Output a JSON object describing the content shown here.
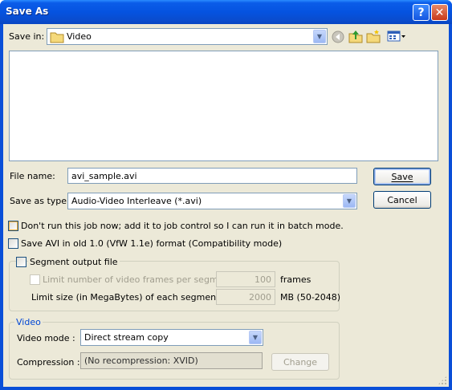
{
  "window": {
    "title": "Save As",
    "help_symbol": "?",
    "close_symbol": "✕"
  },
  "save_in": {
    "label": "Save in:",
    "folder": "Video",
    "icons": [
      "folder-icon",
      "back-icon",
      "up-folder-icon",
      "new-folder-icon",
      "view-menu-icon"
    ]
  },
  "file_name": {
    "label": "File name:",
    "value": "avi_sample.avi"
  },
  "save_as_type": {
    "label": "Save as type:",
    "value": "Audio-Video Interleave (*.avi)"
  },
  "buttons": {
    "save": "Save",
    "cancel": "Cancel",
    "change": "Change"
  },
  "options": {
    "batch_mode": "Don't run this job now; add it to job control so I can run it in batch mode.",
    "old_avi": "Save AVI in old 1.0 (VfW 1.1e) format (Compatibility mode)"
  },
  "segment": {
    "group_label": "Segment output file",
    "limit_frames_label": "Limit number of video frames per segment to",
    "frames_value": "100",
    "frames_unit": "frames",
    "limit_size_label": "Limit size (in MegaBytes) of each segment to :",
    "size_value": "2000",
    "size_unit": "MB (50-2048)"
  },
  "video": {
    "group_label": "Video",
    "mode_label": "Video mode :",
    "mode_value": "Direct stream copy",
    "compression_label": "Compression :",
    "compression_value": "(No recompression: XVID)"
  },
  "colors": {
    "titlebar": "#0553e0",
    "dialog_bg": "#ece9d8",
    "group_title": "#0046d5"
  }
}
